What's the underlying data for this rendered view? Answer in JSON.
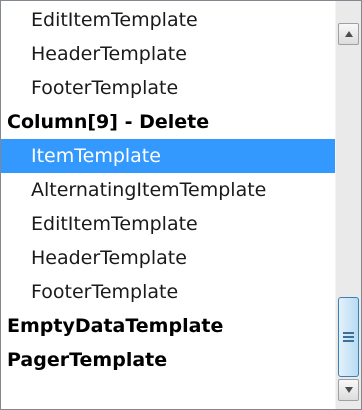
{
  "list": {
    "items": [
      {
        "label": "EditItemTemplate",
        "kind": "child",
        "selected": false
      },
      {
        "label": "HeaderTemplate",
        "kind": "child",
        "selected": false
      },
      {
        "label": "FooterTemplate",
        "kind": "child",
        "selected": false
      },
      {
        "label": "Column[9] - Delete",
        "kind": "group",
        "selected": false
      },
      {
        "label": "ItemTemplate",
        "kind": "child",
        "selected": true
      },
      {
        "label": "AlternatingItemTemplate",
        "kind": "child",
        "selected": false
      },
      {
        "label": "EditItemTemplate",
        "kind": "child",
        "selected": false
      },
      {
        "label": "HeaderTemplate",
        "kind": "child",
        "selected": false
      },
      {
        "label": "FooterTemplate",
        "kind": "child",
        "selected": false
      },
      {
        "label": "EmptyDataTemplate",
        "kind": "group",
        "selected": false
      },
      {
        "label": "PagerTemplate",
        "kind": "group",
        "selected": false
      }
    ]
  },
  "scrollbar": {
    "up_icon": "up-arrow-icon",
    "down_icon": "down-arrow-icon",
    "thumb_icon": "grip-icon"
  },
  "colors": {
    "selection": "#3399ff",
    "selected_text": "#ffffff",
    "text": "#1a1a1a"
  }
}
